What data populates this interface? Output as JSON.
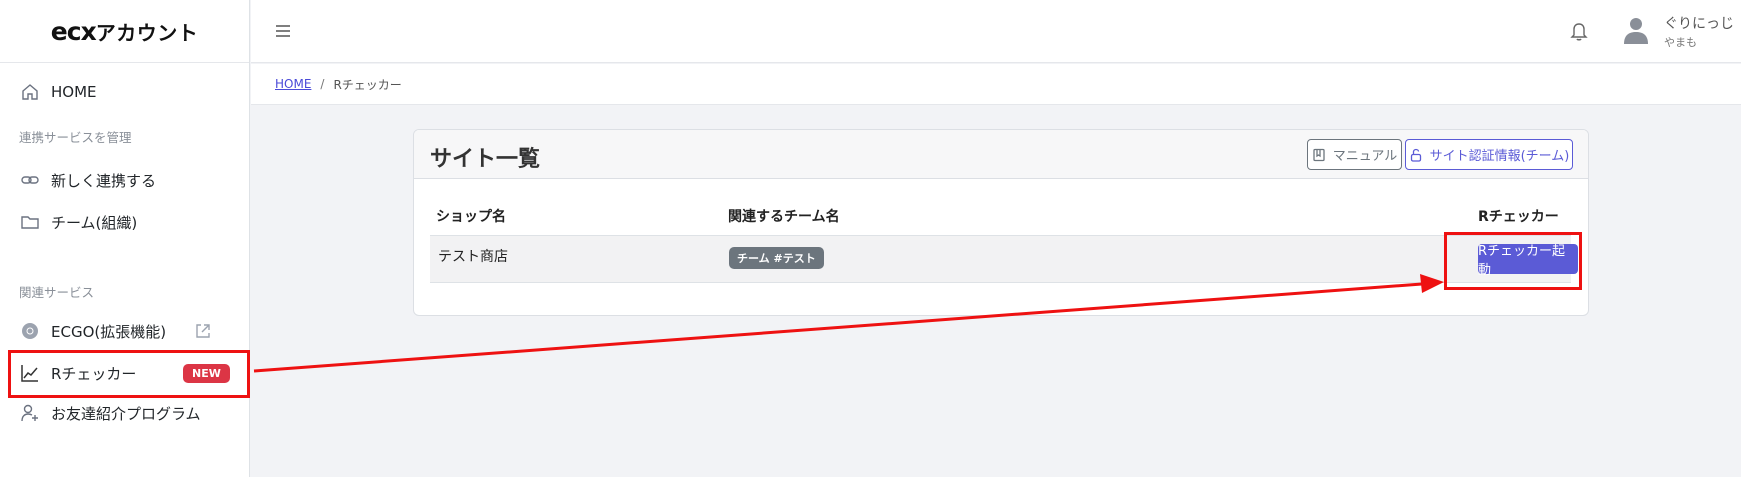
{
  "logo": {
    "brand": "ecx",
    "suffix": "アカウント"
  },
  "sidebar": {
    "home": "HOME",
    "section_manage": "連携サービスを管理",
    "new_integration": "新しく連携する",
    "team": "チーム(組織)",
    "section_related": "関連サービス",
    "ecgo": "ECGO(拡張機能)",
    "rchecker": "Rチェッカー",
    "rchecker_badge": "NEW",
    "referral": "お友達紹介プログラム"
  },
  "header": {
    "user_name": "ぐりにっじ",
    "user_sub": "やまも"
  },
  "breadcrumb": {
    "home": "HOME",
    "separator": "/",
    "current": "Rチェッカー"
  },
  "card": {
    "title": "サイト一覧",
    "manual_button": "マニュアル",
    "auth_button": "サイト認証情報(チーム)",
    "columns": {
      "shop": "ショップ名",
      "team": "関連するチーム名",
      "rchecker": "Rチェッカー"
    },
    "rows": [
      {
        "shop": "テスト商店",
        "team": "チーム #テスト",
        "action": "Rチェッカー起動"
      }
    ]
  },
  "colors": {
    "accent": "#5b5bd6",
    "highlight": "#ee1111",
    "badge_new": "#dc3545",
    "team_badge": "#6c757d"
  }
}
